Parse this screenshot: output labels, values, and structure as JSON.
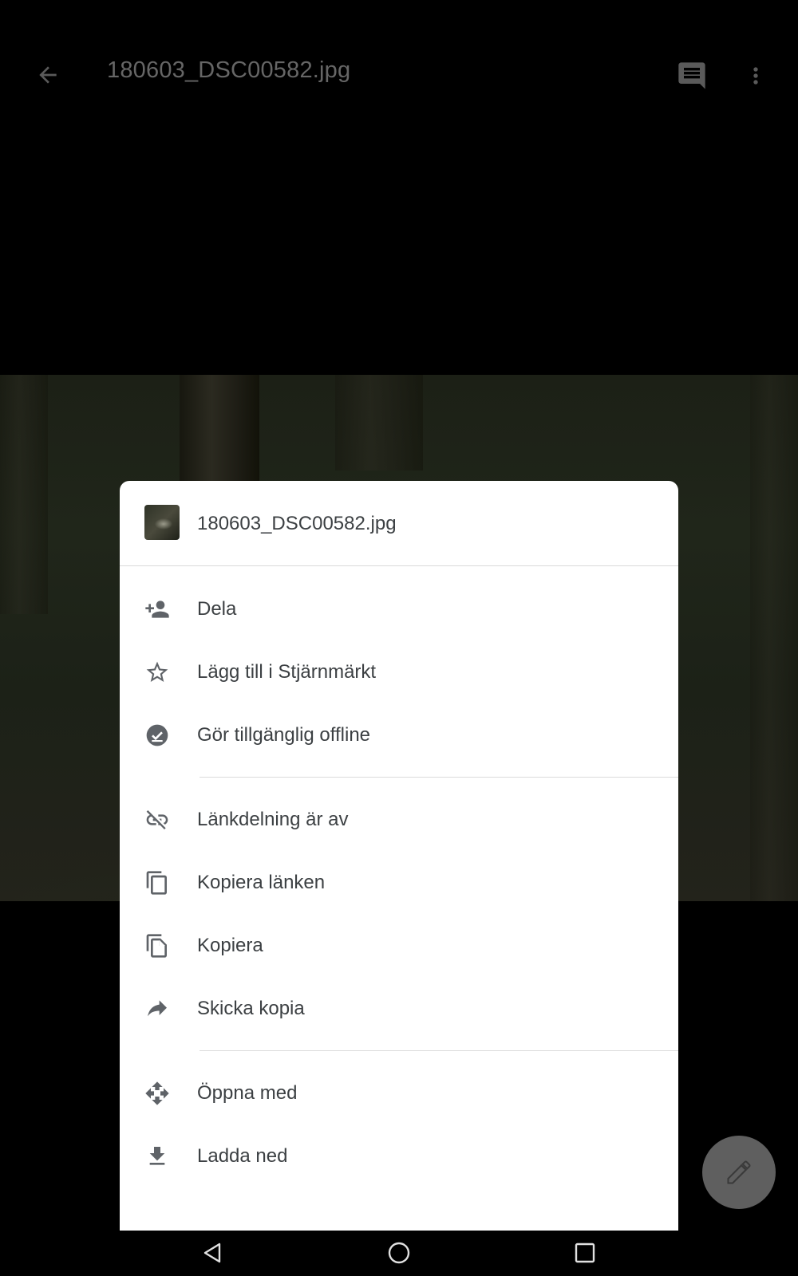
{
  "topbar": {
    "title": "180603_DSC00582.jpg",
    "back_icon": "arrow-back-icon",
    "comment_icon": "comment-icon",
    "more_icon": "more-vert-icon"
  },
  "sheet": {
    "file_name": "180603_DSC00582.jpg",
    "groups": [
      [
        {
          "label": "Dela",
          "icon": "person-add-icon"
        },
        {
          "label": "Lägg till i Stjärnmärkt",
          "icon": "star-outline-icon"
        },
        {
          "label": "Gör tillgänglig offline",
          "icon": "offline-check-icon"
        }
      ],
      [
        {
          "label": "Länkdelning är av",
          "icon": "link-off-icon"
        },
        {
          "label": "Kopiera länken",
          "icon": "copy-icon"
        },
        {
          "label": "Kopiera",
          "icon": "file-copy-icon"
        },
        {
          "label": "Skicka kopia",
          "icon": "forward-icon"
        }
      ],
      [
        {
          "label": "Öppna med",
          "icon": "open-with-icon"
        },
        {
          "label": "Ladda ned",
          "icon": "download-icon"
        }
      ]
    ]
  },
  "fab": {
    "icon": "edit-pencil-icon"
  },
  "navbar": {
    "back_icon": "nav-back-icon",
    "home_icon": "nav-home-icon",
    "recents_icon": "nav-recents-icon"
  },
  "colors": {
    "background": "#000000",
    "sheet": "#ffffff",
    "text": "#3c4043",
    "icon": "#5f6368",
    "fab": "#5f5f5f",
    "topbar_text": "#666666"
  }
}
